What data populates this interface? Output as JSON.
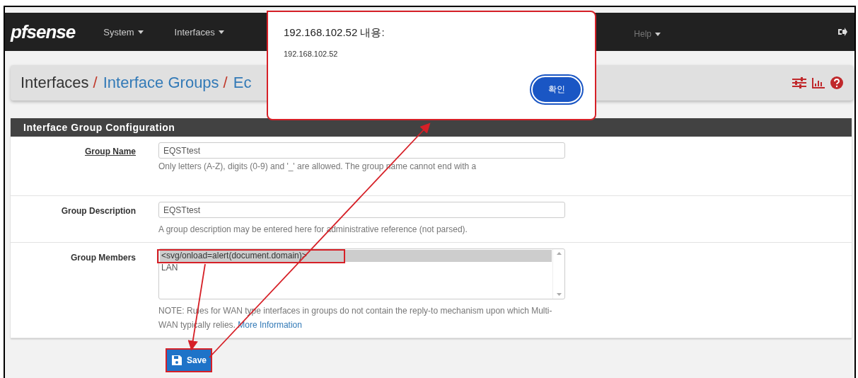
{
  "navbar": {
    "logo": "pfsense",
    "menus": [
      {
        "label": "System"
      },
      {
        "label": "Interfaces"
      },
      {
        "label": "Help"
      }
    ]
  },
  "breadcrumb": [
    {
      "label": "Interfaces",
      "link": false
    },
    {
      "separator": "/",
      "label": "Interface Groups",
      "link": true
    },
    {
      "separator": "/",
      "label": "Ec",
      "link": true
    }
  ],
  "panel": {
    "title": "Interface Group Configuration",
    "fields": [
      {
        "kind": "text",
        "label": "Group Name",
        "underlined": true,
        "value": "EQSTtest",
        "help": "Only letters (A-Z), digits (0-9) and '_' are allowed. The group name cannot end with a"
      },
      {
        "kind": "text",
        "label": "Group Description",
        "underlined": false,
        "value": "EQSTtest",
        "help": "A group description may be entered here for administrative reference (not parsed)."
      },
      {
        "kind": "list",
        "label": "Group Members",
        "options": [
          {
            "label": "<svg/onload=alert(document.domain)>",
            "selected": true
          },
          {
            "label": "LAN",
            "selected": false
          }
        ],
        "help": "NOTE: Rules for WAN type interfaces in groups do not contain the reply-to mechanism upon which Multi-WAN typically relies.",
        "help_link": "More Information"
      }
    ]
  },
  "save_button": "Save",
  "dialog": {
    "title": "192.168.102.52 내용:",
    "message": "192.168.102.52",
    "ok": "확인"
  }
}
